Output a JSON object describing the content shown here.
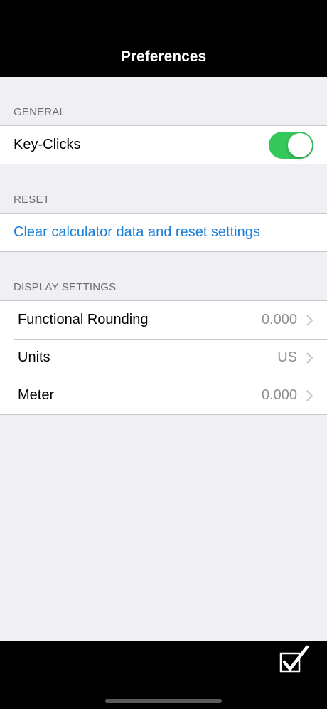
{
  "nav": {
    "title": "Preferences"
  },
  "sections": {
    "general": {
      "header": "GENERAL",
      "key_clicks": {
        "label": "Key-Clicks",
        "enabled": true
      }
    },
    "reset": {
      "header": "RESET",
      "clear_label": "Clear calculator data and reset settings"
    },
    "display": {
      "header": "DISPLAY SETTINGS",
      "items": [
        {
          "label": "Functional Rounding",
          "value": "0.000"
        },
        {
          "label": "Units",
          "value": "US"
        },
        {
          "label": "Meter",
          "value": "0.000"
        }
      ]
    }
  },
  "toolbar": {
    "done_icon": "checkbox-checked-icon"
  },
  "colors": {
    "accent": "#1a7fd6",
    "toggle_on": "#34c759",
    "bar_background": "#000000"
  }
}
